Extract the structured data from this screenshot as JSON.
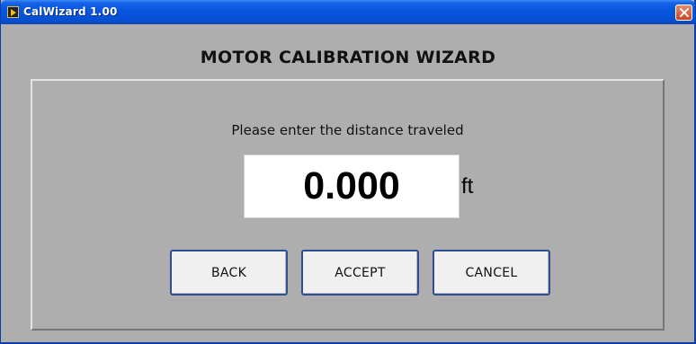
{
  "window": {
    "title": "CalWizard  1.00",
    "close_icon": "close-icon",
    "app_icon": "labview-run-icon"
  },
  "wizard": {
    "heading": "MOTOR CALIBRATION WIZARD",
    "prompt": "Please enter the distance traveled",
    "distance_value": "0.000",
    "unit": "ft"
  },
  "buttons": {
    "back_label": "BACK",
    "accept_label": "ACCEPT",
    "cancel_label": "CANCEL"
  },
  "colors": {
    "titlebar": "#0855dd",
    "close_button": "#cc4522",
    "background": "#aeaeae",
    "button_border": "#2e4f96"
  }
}
